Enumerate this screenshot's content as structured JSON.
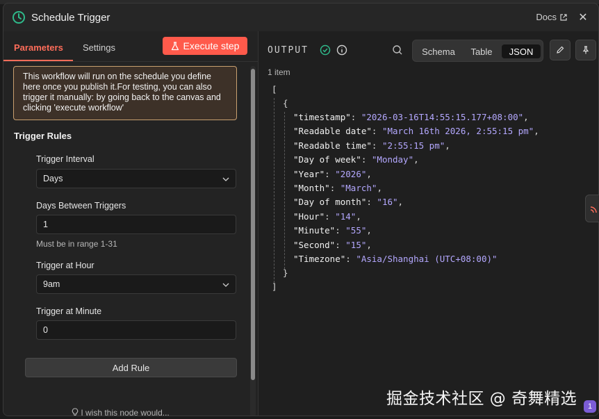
{
  "window": {
    "title": "Schedule Trigger",
    "docs_label": "Docs",
    "close_label": "✕"
  },
  "left": {
    "tabs": [
      {
        "label": "Parameters"
      },
      {
        "label": "Settings"
      }
    ],
    "execute_label": "Execute step",
    "notice": "This workflow will run on the schedule you define here once you publish it.For testing, you can also trigger it manually: by going back to the canvas and clicking 'execute workflow'",
    "section_title": "Trigger Rules",
    "fields": {
      "interval_label": "Trigger Interval",
      "interval_value": "Days",
      "days_label": "Days Between Triggers",
      "days_value": "1",
      "days_hint": "Must be in range 1-31",
      "hour_label": "Trigger at Hour",
      "hour_value": "9am",
      "minute_label": "Trigger at Minute",
      "minute_value": "0"
    },
    "add_rule_label": "Add Rule",
    "wish_label": "I wish this node would..."
  },
  "right": {
    "output_label": "OUTPUT",
    "view_modes": [
      {
        "label": "Schema"
      },
      {
        "label": "Table"
      },
      {
        "label": "JSON"
      }
    ],
    "active_view": "JSON",
    "item_count": "1 item",
    "json": [
      {
        "key": "\"timestamp\"",
        "value": "\"2026-03-16T14:55:15.177+08:00\""
      },
      {
        "key": "\"Readable date\"",
        "value": "\"March 16th 2026, 2:55:15 pm\""
      },
      {
        "key": "\"Readable time\"",
        "value": "\"2:55:15 pm\""
      },
      {
        "key": "\"Day of week\"",
        "value": "\"Monday\""
      },
      {
        "key": "\"Year\"",
        "value": "\"2026\""
      },
      {
        "key": "\"Month\"",
        "value": "\"March\""
      },
      {
        "key": "\"Day of month\"",
        "value": "\"16\""
      },
      {
        "key": "\"Hour\"",
        "value": "\"14\""
      },
      {
        "key": "\"Minute\"",
        "value": "\"55\""
      },
      {
        "key": "\"Second\"",
        "value": "\"15\""
      },
      {
        "key": "\"Timezone\"",
        "value": "\"Asia/Shanghai (UTC+08:00)\""
      }
    ]
  },
  "watermark": "掘金技术社区 @ 奇舞精选",
  "notification_badge": "1",
  "colors": {
    "accent": "#ff6d5a",
    "success": "#2fb98a",
    "json_string": "#b4a8ff"
  }
}
